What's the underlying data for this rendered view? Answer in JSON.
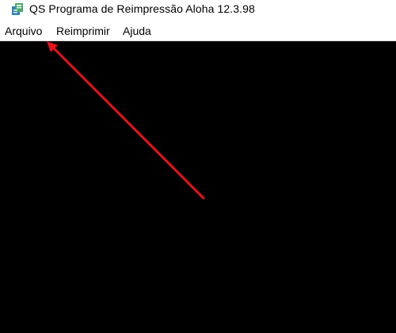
{
  "window": {
    "title": "QS Programa de Reimpressão Aloha 12.3.98",
    "icon": "app-icon"
  },
  "menubar": {
    "items": [
      {
        "label": "Arquivo"
      },
      {
        "label": "Reimprimir"
      },
      {
        "label": "Ajuda"
      }
    ]
  },
  "content": {
    "background": "#000000"
  },
  "annotation": {
    "type": "arrow",
    "color": "#e8121a",
    "points_to": "Arquivo"
  }
}
